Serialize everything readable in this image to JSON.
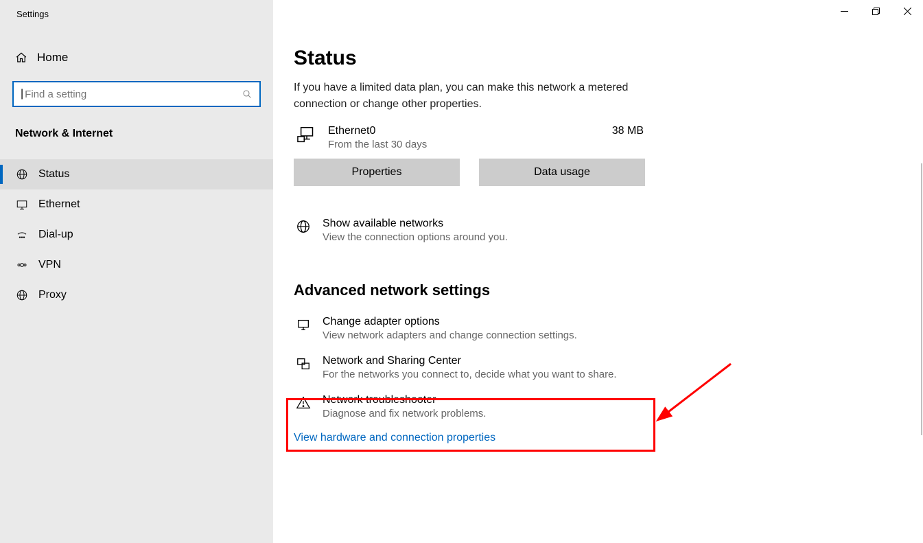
{
  "window": {
    "title": "Settings"
  },
  "sidebar": {
    "home_label": "Home",
    "search_placeholder": "Find a setting",
    "section_label": "Network & Internet",
    "items": [
      {
        "label": "Status",
        "active": true
      },
      {
        "label": "Ethernet"
      },
      {
        "label": "Dial-up"
      },
      {
        "label": "VPN"
      },
      {
        "label": "Proxy"
      }
    ]
  },
  "main": {
    "title": "Status",
    "description": "If you have a limited data plan, you can make this network a metered connection or change other properties.",
    "connection": {
      "name": "Ethernet0",
      "subtitle": "From the last 30 days",
      "usage": "38 MB"
    },
    "buttons": {
      "properties": "Properties",
      "data_usage": "Data usage"
    },
    "available": {
      "title": "Show available networks",
      "subtitle": "View the connection options around you."
    },
    "advanced_title": "Advanced network settings",
    "advanced": [
      {
        "title": "Change adapter options",
        "subtitle": "View network adapters and change connection settings."
      },
      {
        "title": "Network and Sharing Center",
        "subtitle": "For the networks you connect to, decide what you want to share."
      },
      {
        "title": "Network troubleshooter",
        "subtitle": "Diagnose and fix network problems."
      }
    ],
    "link": "View hardware and connection properties"
  }
}
